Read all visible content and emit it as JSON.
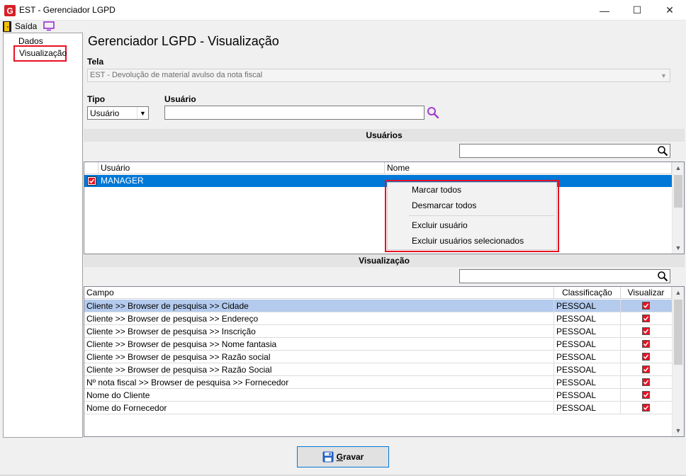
{
  "window": {
    "title": "EST - Gerenciador LGPD",
    "minimize": "—",
    "maximize": "☐",
    "close": "✕"
  },
  "toolbar": {
    "exit_label": "Saída"
  },
  "nav": {
    "items": [
      {
        "label": "Dados"
      },
      {
        "label": "Visualização"
      }
    ]
  },
  "page": {
    "title": "Gerenciador LGPD - Visualização"
  },
  "form": {
    "tela_label": "Tela",
    "tela_value": "EST - Devolução de material avulso da nota fiscal",
    "tipo_label": "Tipo",
    "tipo_value": "Usuário",
    "usuario_label": "Usuário",
    "usuario_value": ""
  },
  "usuarios": {
    "header": "Usuários",
    "columns": [
      "Usuário",
      "Nome"
    ],
    "rows": [
      {
        "usuario": "MANAGER",
        "nome": "",
        "checked": true
      }
    ]
  },
  "context_menu": {
    "items": [
      "Marcar todos",
      "Desmarcar todos",
      "Excluir usuário",
      "Excluir usuários selecionados"
    ]
  },
  "visualizacao": {
    "header": "Visualização",
    "columns": [
      "Campo",
      "Classificação",
      "Visualizar"
    ],
    "rows": [
      {
        "campo": "Cliente >> Browser de pesquisa >> Cidade",
        "classificacao": "PESSOAL",
        "visualizar": true
      },
      {
        "campo": "Cliente >> Browser de pesquisa >> Endereço",
        "classificacao": "PESSOAL",
        "visualizar": true
      },
      {
        "campo": "Cliente >> Browser de pesquisa >> Inscrição",
        "classificacao": "PESSOAL",
        "visualizar": true
      },
      {
        "campo": "Cliente >> Browser de pesquisa >> Nome fantasia",
        "classificacao": "PESSOAL",
        "visualizar": true
      },
      {
        "campo": "Cliente >> Browser de pesquisa >> Razão social",
        "classificacao": "PESSOAL",
        "visualizar": true
      },
      {
        "campo": "Cliente >> Browser de pesquisa >> Razão Social",
        "classificacao": "PESSOAL",
        "visualizar": true
      },
      {
        "campo": "Nº nota fiscal >> Browser de pesquisa >> Fornecedor",
        "classificacao": "PESSOAL",
        "visualizar": true
      },
      {
        "campo": "Nome do Cliente",
        "classificacao": "PESSOAL",
        "visualizar": true
      },
      {
        "campo": "Nome do Fornecedor",
        "classificacao": "PESSOAL",
        "visualizar": true
      }
    ]
  },
  "actions": {
    "save_label": "Gravar"
  },
  "colors": {
    "accent": "#0078d7",
    "highlight_outline": "#e81123",
    "selected_row": "#b4cbee",
    "check_red": "#e81123"
  }
}
